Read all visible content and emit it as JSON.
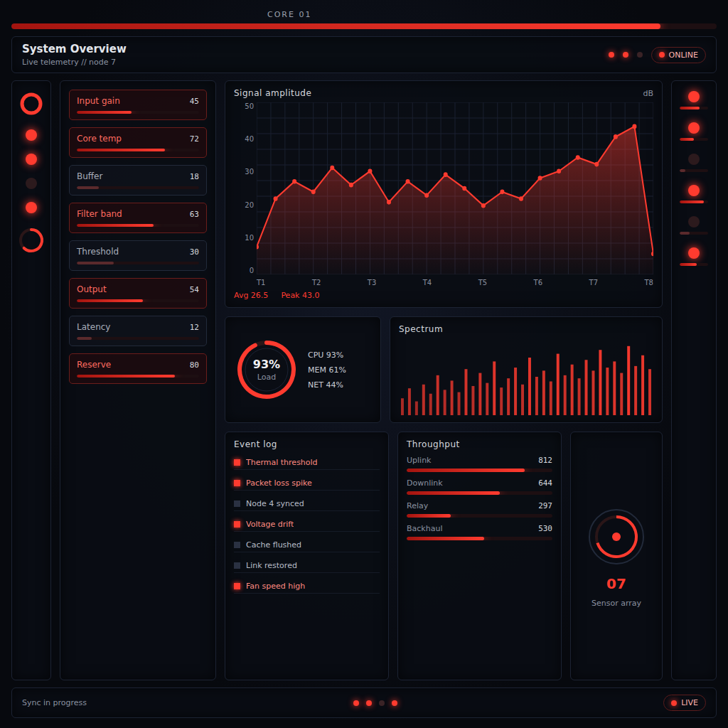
{
  "top": {
    "label": "CORE 01",
    "level": 0.92
  },
  "header": {
    "title": "System Overview",
    "subtitle": "Live telemetry // node 7",
    "status": "ONLINE"
  },
  "left_rail": {
    "indicators": [
      {
        "on": true
      },
      {
        "on": true
      },
      {
        "on": false
      },
      {
        "on": true
      }
    ],
    "level": 0.62
  },
  "controls": [
    {
      "label": "Input gain",
      "value": "45",
      "level": 0.45,
      "active": true
    },
    {
      "label": "Core temp",
      "value": "72",
      "level": 0.72,
      "active": true
    },
    {
      "label": "Buffer",
      "value": "18",
      "level": 0.18,
      "active": false
    },
    {
      "label": "Filter band",
      "value": "63",
      "level": 0.63,
      "active": true
    },
    {
      "label": "Threshold",
      "value": "30",
      "level": 0.3,
      "active": false
    },
    {
      "label": "Output",
      "value": "54",
      "level": 0.54,
      "active": true
    },
    {
      "label": "Latency",
      "value": "12",
      "level": 0.12,
      "active": false
    },
    {
      "label": "Reserve",
      "value": "80",
      "level": 0.8,
      "active": true
    }
  ],
  "chart": {
    "title": "Signal amplitude",
    "unit": "dB",
    "y_ticks": [
      "50",
      "40",
      "30",
      "20",
      "10",
      "0"
    ],
    "x_ticks": [
      "T1",
      "T2",
      "T3",
      "T4",
      "T5",
      "T6",
      "T7",
      "T8"
    ],
    "series": [
      {
        "name": "Signal",
        "values": [
          8,
          22,
          27,
          24,
          31,
          26,
          30,
          21,
          27,
          23,
          29,
          25,
          20,
          24,
          22,
          28,
          30,
          34,
          32,
          40,
          43,
          6
        ]
      }
    ],
    "stats": [
      "Avg 26.5",
      "Peak 43.0"
    ]
  },
  "gauge": {
    "label": "Load",
    "value": "93%",
    "level": 0.93,
    "lines": [
      "CPU 93%",
      "MEM 61%",
      "NET 44%"
    ]
  },
  "bars": {
    "title": "Spectrum",
    "values": [
      22,
      35,
      18,
      40,
      28,
      52,
      33,
      45,
      30,
      60,
      38,
      55,
      42,
      70,
      36,
      48,
      62,
      40,
      75,
      50,
      58,
      44,
      80,
      52,
      66,
      48,
      72,
      58,
      85,
      62,
      70,
      55,
      90,
      64,
      78,
      60
    ]
  },
  "log": {
    "title": "Event log",
    "rows": [
      {
        "text": "Thermal threshold",
        "flagged": true
      },
      {
        "text": "Packet loss spike",
        "flagged": true
      },
      {
        "text": "Node 4 synced",
        "flagged": false
      },
      {
        "text": "Voltage drift",
        "flagged": true
      },
      {
        "text": "Cache flushed",
        "flagged": false
      },
      {
        "text": "Link restored",
        "flagged": false
      },
      {
        "text": "Fan speed high",
        "flagged": true
      }
    ]
  },
  "readings": {
    "title": "Throughput",
    "rows": [
      {
        "label": "Uplink",
        "value": "812",
        "level": 0.81
      },
      {
        "label": "Downlink",
        "value": "644",
        "level": 0.64
      },
      {
        "label": "Relay",
        "value": "297",
        "level": 0.3
      },
      {
        "label": "Backhaul",
        "value": "530",
        "level": 0.53
      }
    ]
  },
  "dial": {
    "label": "Sensor array",
    "value": "07",
    "level": 0.7
  },
  "right_rail": {
    "items": [
      {
        "on": true,
        "level": 0.7
      },
      {
        "on": true,
        "level": 0.5
      },
      {
        "on": false,
        "level": 0.2
      },
      {
        "on": true,
        "level": 0.85
      },
      {
        "on": false,
        "level": 0.35
      },
      {
        "on": true,
        "level": 0.6
      }
    ]
  },
  "footer": {
    "label": "Sync in progress",
    "status": "LIVE"
  }
}
